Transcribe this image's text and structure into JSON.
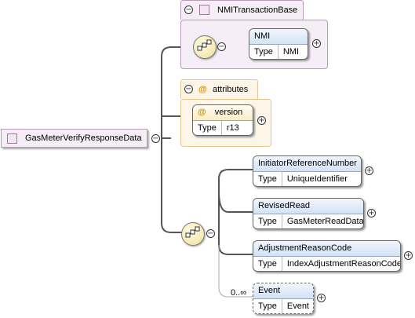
{
  "root": {
    "label": "GasMeterVerifyResponseData"
  },
  "base_group": {
    "label": "NMITransactionBase",
    "element": {
      "name": "NMI",
      "type_key": "Type",
      "type_value": "NMI"
    }
  },
  "attributes_group": {
    "label": "attributes",
    "at_symbol": "@",
    "attribute": {
      "name": "version",
      "type_key": "Type",
      "type_value": "r13"
    }
  },
  "sequence_elements": [
    {
      "name": "InitiatorReferenceNumber",
      "type_key": "Type",
      "type_value": "UniqueIdentifier"
    },
    {
      "name": "RevisedRead",
      "type_key": "Type",
      "type_value": "GasMeterReadData"
    },
    {
      "name": "AdjustmentReasonCode",
      "type_key": "Type",
      "type_value": "IndexAdjustmentReasonCode"
    },
    {
      "name": "Event",
      "type_key": "Type",
      "type_value": "Event",
      "multiplicity": "0..∞"
    }
  ],
  "symbols": {
    "expand": "+",
    "collapse": "−"
  },
  "colors": {
    "group_border": "#b99ab9",
    "group_fill": "#f6eef6",
    "attr_fill": "#fdf6e8",
    "header_blue": "#d3e2f6"
  }
}
